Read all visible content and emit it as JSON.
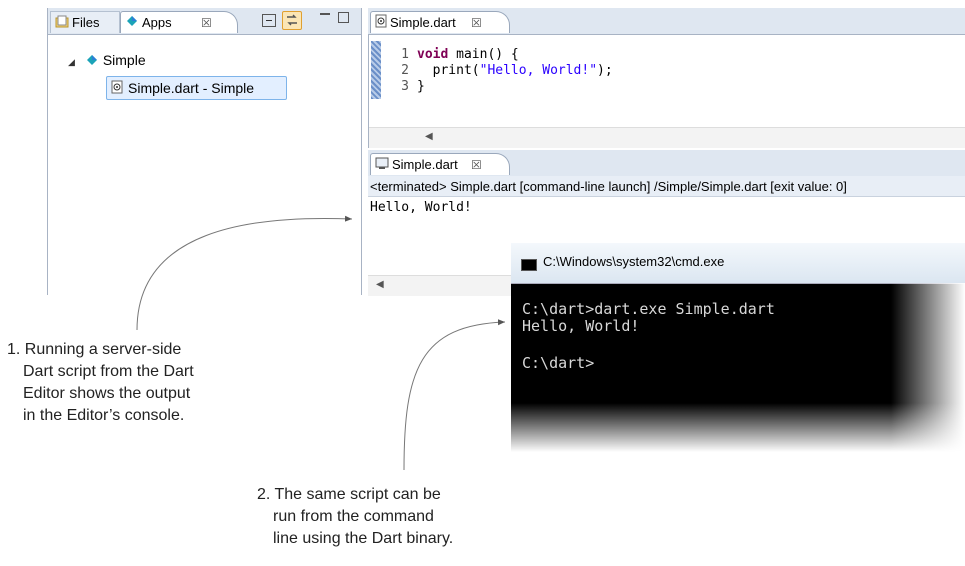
{
  "explorer": {
    "files_tab": "Files",
    "apps_tab": "Apps",
    "close_glyph": "☒",
    "tree": {
      "project": "Simple",
      "file": "Simple.dart - Simple"
    }
  },
  "editor": {
    "tab_label": "Simple.dart",
    "close_glyph": "☒",
    "lines": [
      {
        "num": "1",
        "keyword": "void",
        "rest": " main() {"
      },
      {
        "num": "2",
        "pre": "  print(",
        "string": "\"Hello, World!\"",
        "post": ");"
      },
      {
        "num": "3",
        "rest": "}"
      }
    ]
  },
  "console": {
    "tab_label": "Simple.dart",
    "close_glyph": "☒",
    "status": "<terminated> Simple.dart [command-line launch] /Simple/Simple.dart [exit value: 0]",
    "output": "Hello, World!"
  },
  "cmd": {
    "title": "C:\\Windows\\system32\\cmd.exe",
    "lines": [
      "C:\\dart>dart.exe Simple.dart",
      "Hello, World!",
      "",
      "C:\\dart>"
    ]
  },
  "annotations": {
    "caption_1": [
      "1. Running a server-side",
      "Dart script from the Dart",
      "Editor shows the output",
      "in the Editor’s console."
    ],
    "caption_2": [
      "2. The same script can be",
      "run from the command",
      "line using the Dart binary."
    ]
  },
  "colors": {
    "keyword": "#7f0055",
    "string": "#2a00ff",
    "selection": "#e3efff"
  }
}
